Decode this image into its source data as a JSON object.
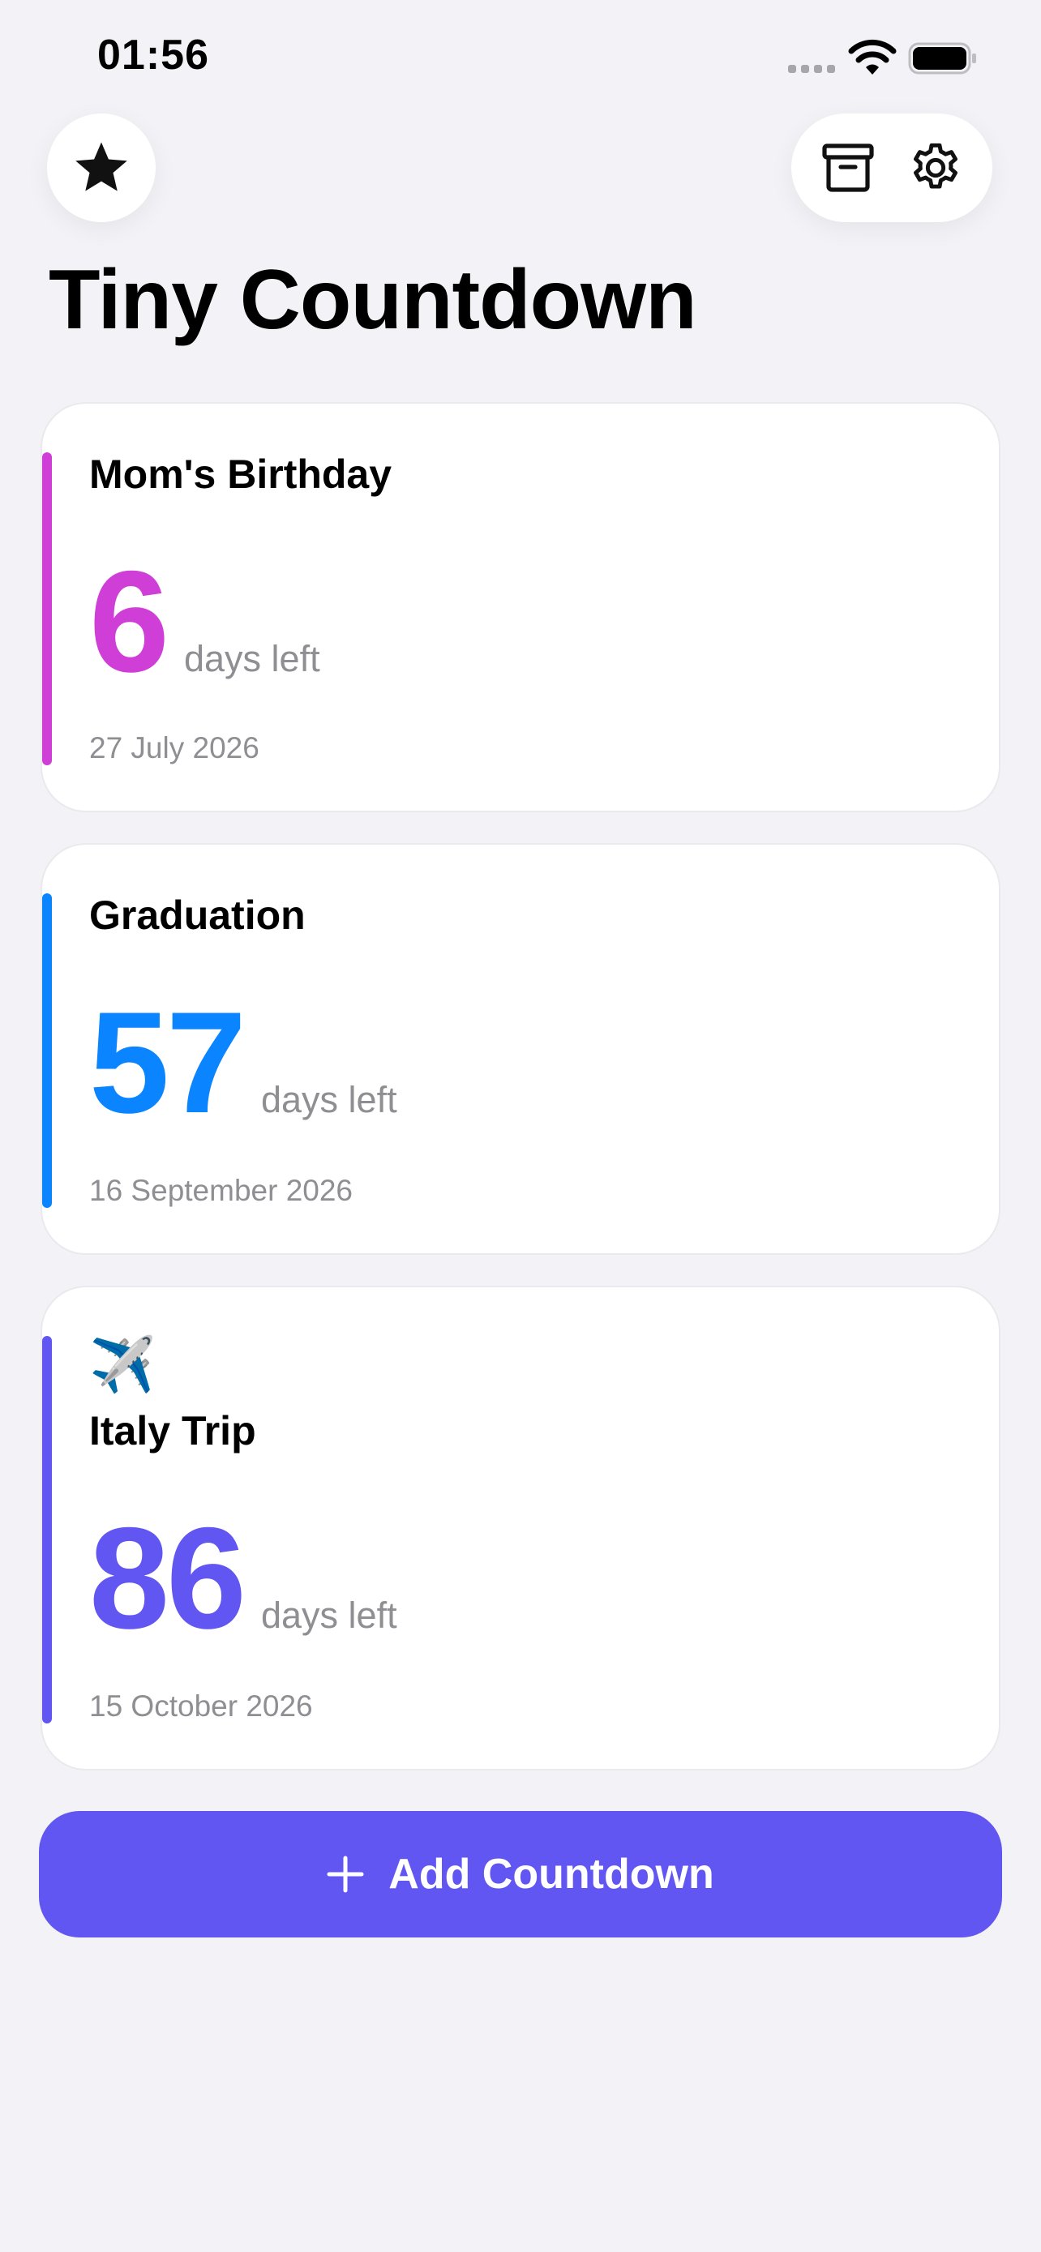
{
  "status_bar": {
    "time": "01:56"
  },
  "header": {
    "title": "Tiny Countdown",
    "icons": {
      "favorites": "star-icon",
      "archive": "archive-box-icon",
      "settings": "gear-icon"
    }
  },
  "countdowns": [
    {
      "emoji": "",
      "title": "Mom's Birthday",
      "count": "6",
      "unit_label": "days left",
      "date": "27 July 2026",
      "color": "#D03ED8"
    },
    {
      "emoji": "",
      "title": "Graduation",
      "count": "57",
      "unit_label": "days left",
      "date": "16 September 2026",
      "color": "#0A84FF"
    },
    {
      "emoji": "✈️",
      "title": "Italy Trip",
      "count": "86",
      "unit_label": "days left",
      "date": "15 October 2026",
      "color": "#6156F2"
    }
  ],
  "add_button": {
    "label": "Add Countdown",
    "color": "#6156F2"
  }
}
